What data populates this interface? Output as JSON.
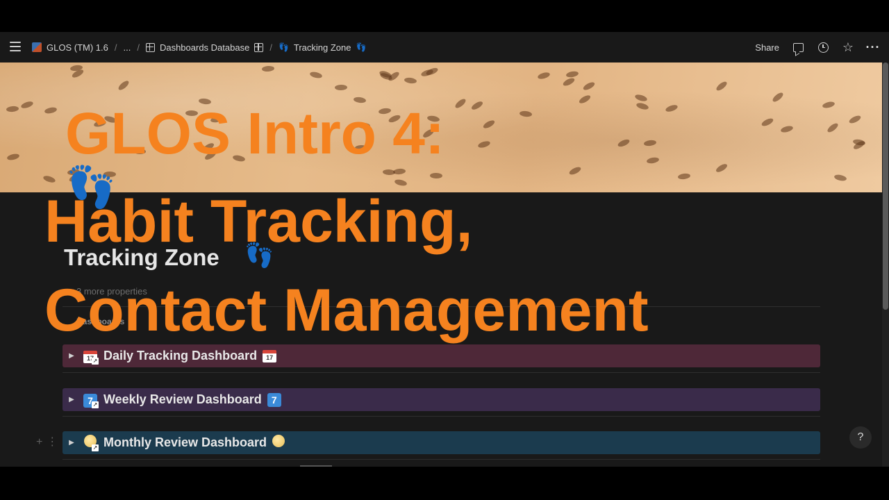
{
  "topbar": {
    "crumbs": [
      {
        "label": "GLOS (TM) 1.6"
      },
      {
        "label": "..."
      },
      {
        "label": "Dashboards Database"
      },
      {
        "label": "Tracking Zone"
      }
    ],
    "share_label": "Share"
  },
  "page": {
    "title": "Tracking Zone",
    "props_label": "3 more properties",
    "section_label": "Dashboards"
  },
  "toggles": [
    {
      "label": "Daily Tracking Dashboard",
      "color": "#4e2838",
      "icon": "calendar-icon"
    },
    {
      "label": "Weekly Review Dashboard",
      "color": "#3a2b4a",
      "icon": "keycap-seven-icon"
    },
    {
      "label": "Monthly Review Dashboard",
      "color": "#1b3b4e",
      "icon": "moon-icon"
    }
  ],
  "icon_texts": {
    "calendar_day": "17",
    "seven": "7"
  },
  "help_label": "?",
  "overlay": {
    "line1": "GLOS Intro 4:",
    "line2": "Habit Tracking,",
    "line3": "Contact Management",
    "color": "#f5821f"
  }
}
